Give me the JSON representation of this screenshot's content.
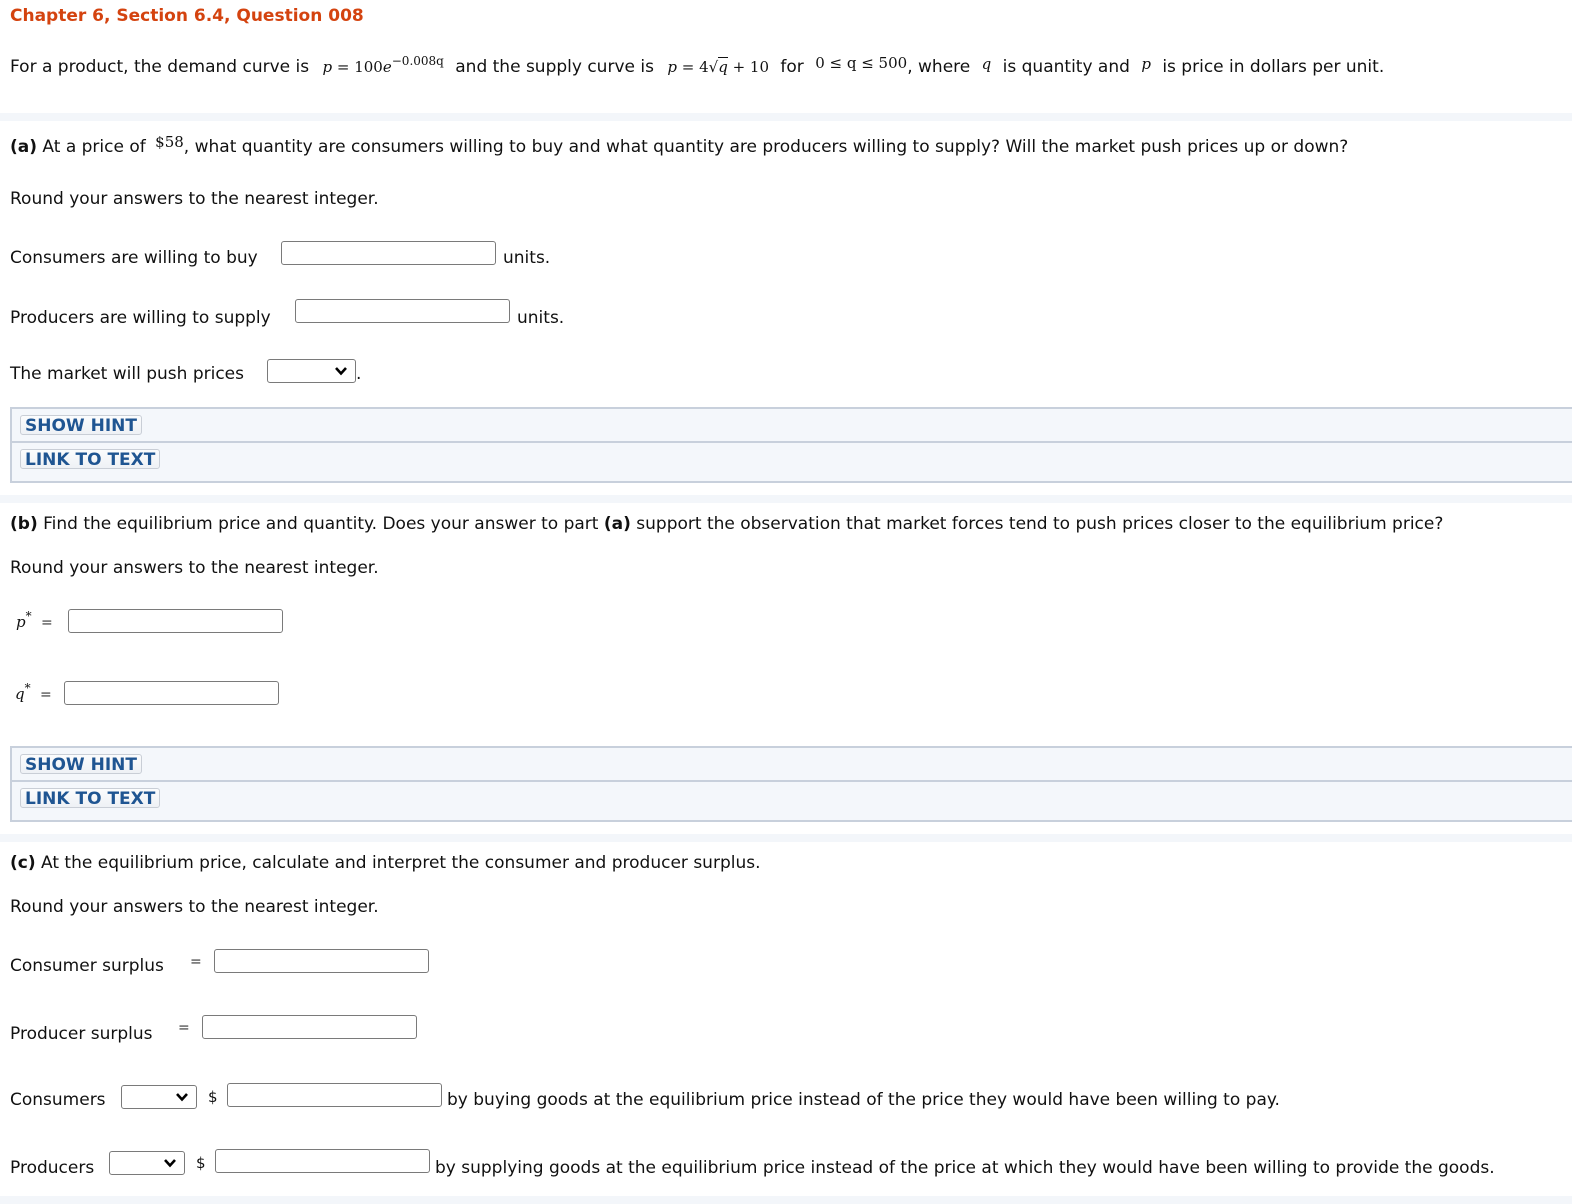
{
  "header": {
    "title": "Chapter 6, Section 6.4, Question 008"
  },
  "problem": {
    "intro_1": "For a product, the demand curve is",
    "demand_lhs": "p",
    "demand_eq": " = 100",
    "demand_e": "e",
    "demand_exp": "−0.008q",
    "intro_2": "and the supply curve is",
    "supply_lhs": "p",
    "supply_eq": " = 4",
    "supply_rad": "q",
    "supply_tail": " + 10",
    "intro_3": "for",
    "domain": "0 ≤ q ≤ 500",
    "intro_4": ", where",
    "var_q": "q",
    "intro_5": "is quantity and",
    "var_p": "p",
    "intro_6": "is price in dollars per unit."
  },
  "part_a": {
    "label": "(a)",
    "text_1": "At a price of",
    "price": "$58",
    "text_2": ", what quantity are consumers willing to buy and what quantity are producers willing to supply? Will the market push prices up or down?",
    "round_note": "Round your answers to the nearest integer.",
    "consumers_label": "Consumers are willing to buy",
    "consumers_value": "",
    "consumers_unit": "units.",
    "producers_label": "Producers are willing to supply",
    "producers_value": "",
    "producers_unit": "units.",
    "market_label": "The market will push prices",
    "market_selected": "",
    "market_period": ".",
    "show_hint": "SHOW HINT",
    "link_to_text": "LINK TO TEXT"
  },
  "part_b": {
    "label": "(b)",
    "text_1": "Find the equilibrium price and quantity. Does your answer to part",
    "ref": "(a)",
    "text_2": "support the observation that market forces tend to push prices closer to the equilibrium price?",
    "round_note": "Round your answers to the nearest integer.",
    "p_var": "p",
    "p_star": "*",
    "q_var": "q",
    "q_star": "*",
    "equals": "=",
    "p_value": "",
    "q_value": "",
    "show_hint": "SHOW HINT",
    "link_to_text": "LINK TO TEXT"
  },
  "part_c": {
    "label": "(c)",
    "text_1": "At the equilibrium price, calculate and interpret the consumer and producer surplus.",
    "round_note": "Round your answers to the nearest integer.",
    "cs_label": "Consumer surplus",
    "ps_label": "Producer surplus",
    "equals": "=",
    "cs_value": "",
    "ps_value": "",
    "consumers_label": "Consumers",
    "consumers_selected": "",
    "dollar": "$",
    "consumers_amount": "",
    "consumers_tail": "by buying goods at the equilibrium price instead of the price they would have been willing to pay.",
    "producers_label": "Producers",
    "producers_selected": "",
    "producers_amount": "",
    "producers_tail": "by supplying goods at the equilibrium price instead of the price at which they would have been willing to provide the goods."
  },
  "icons": {
    "dropdown": "chevron-down-icon"
  },
  "colors": {
    "title": "#d4430f",
    "hint_text": "#1f5592",
    "band": "#f3f6fa",
    "hint_border": "#c8d0dc"
  }
}
